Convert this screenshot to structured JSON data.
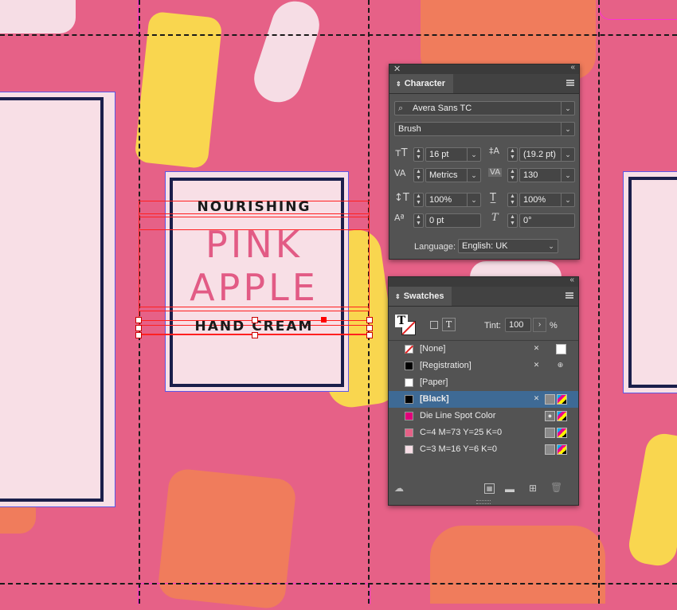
{
  "character_panel": {
    "tab_label": "Character",
    "font_family": "Avera Sans TC",
    "font_style": "Brush",
    "font_size": "16 pt",
    "leading": "(19.2 pt)",
    "kerning": "Metrics",
    "tracking": "130",
    "vertical_scale": "100%",
    "horizontal_scale": "100%",
    "baseline_shift": "0 pt",
    "skew": "0°",
    "language_label": "Language:",
    "language": "English: UK"
  },
  "swatches_panel": {
    "tab_label": "Swatches",
    "tint_label": "Tint:",
    "tint_value": "100",
    "tint_unit": "%",
    "items": [
      {
        "name": "[None]",
        "color": "none"
      },
      {
        "name": "[Registration]",
        "color": "#000000"
      },
      {
        "name": "[Paper]",
        "color": "#ffffff"
      },
      {
        "name": "[Black]",
        "color": "#000000",
        "selected": true
      },
      {
        "name": "Die Line Spot Color",
        "color": "#e0007a"
      },
      {
        "name": "C=4 M=73 Y=25 K=0",
        "color": "#e66187"
      },
      {
        "name": "C=3 M=16 Y=6 K=0",
        "color": "#f6dde5"
      }
    ]
  },
  "artwork": {
    "line1": "NOURISHING",
    "line2": "PINK",
    "line3": "APPLE",
    "line4": "HAND CREAM",
    "background_color": "#e66187",
    "pink_text_color": "#e25b85",
    "navy_color": "#1b1f4b"
  }
}
